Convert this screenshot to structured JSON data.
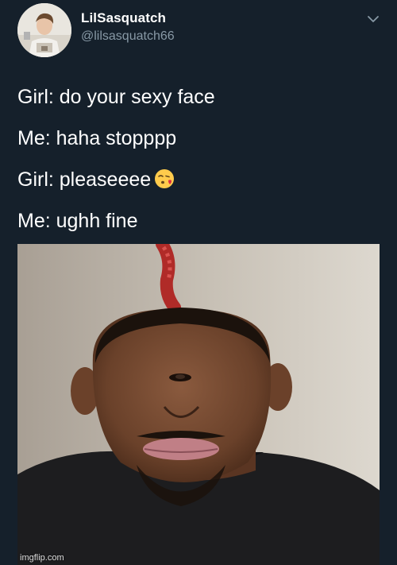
{
  "tweet": {
    "author": {
      "display_name": "LilSasquatch",
      "handle": "@lilsasquatch66"
    },
    "lines": [
      "Girl: do your sexy face",
      "Me: haha stopppp",
      "Girl: pleaseeee",
      "Me: ughh fine"
    ],
    "line_emoji": {
      "index": 2,
      "icon": "kissing-face-heart-emoji"
    },
    "menu_icon": "chevron-down-icon"
  },
  "watermark": "imgflip.com",
  "colors": {
    "background": "#15202b",
    "text_primary": "#ffffff",
    "text_secondary": "#8899a6"
  }
}
